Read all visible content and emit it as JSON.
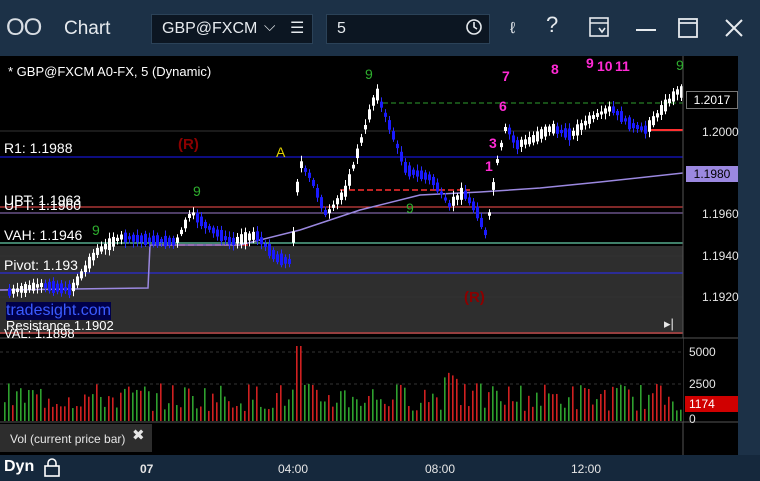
{
  "window": {
    "app_icon": "OO",
    "title": "Chart"
  },
  "toolbar": {
    "symbol": "GBP@FXCM",
    "symbol_menu_icon": "chevron-down-icon",
    "period": "5"
  },
  "chart": {
    "legend": "* GBP@FXCM A0-FX, 5 (Dynamic)",
    "levels": {
      "r1": "R1: 1.1988",
      "upt": "UPT: 1.1960",
      "upt_overlap": "UPT: 1.1963",
      "vah": "VAH: 1.1946",
      "pivot": "Pivot: 1.193",
      "val": "VAL: 1.1898",
      "resistance": "Resistance 1.1902"
    },
    "watermark": "tradesight.com",
    "markers": {
      "r_top": "(R)",
      "r_bottom": "(R)",
      "a": "A"
    },
    "count_labels": {
      "magenta": [
        "7",
        "6",
        "3",
        "1",
        "8",
        "9",
        "10",
        "11"
      ],
      "green": [
        "9",
        "9",
        "9",
        "9",
        "9"
      ]
    },
    "price_axis": [
      "1.2000",
      "1.1960",
      "1.1940",
      "1.1920"
    ],
    "price_tags": [
      {
        "value": "1.2017",
        "bg": "#000000",
        "fg": "#ffffff"
      },
      {
        "value": "1.1980",
        "bg": "#9b88e0",
        "fg": "#000000"
      }
    ],
    "colors": {
      "up_bar": "#ffffff",
      "down_bar": "#0000ff",
      "r1_line": "#1a1aff",
      "upt_line": "#ff4040",
      "vah_line": "#7fffd4",
      "sma": "#9b88e0",
      "pivot_line": "#2a2aff",
      "bg_band": "#333333"
    }
  },
  "volume": {
    "axis": [
      "5000",
      "2500",
      "0"
    ],
    "last": "1174",
    "label": "Vol (current price bar)",
    "close_icon": "close-icon"
  },
  "timeline": {
    "mode": "Dyn",
    "lock_icon": "lock-icon",
    "labels": [
      "07",
      "04:00",
      "08:00",
      "12:00"
    ]
  }
}
